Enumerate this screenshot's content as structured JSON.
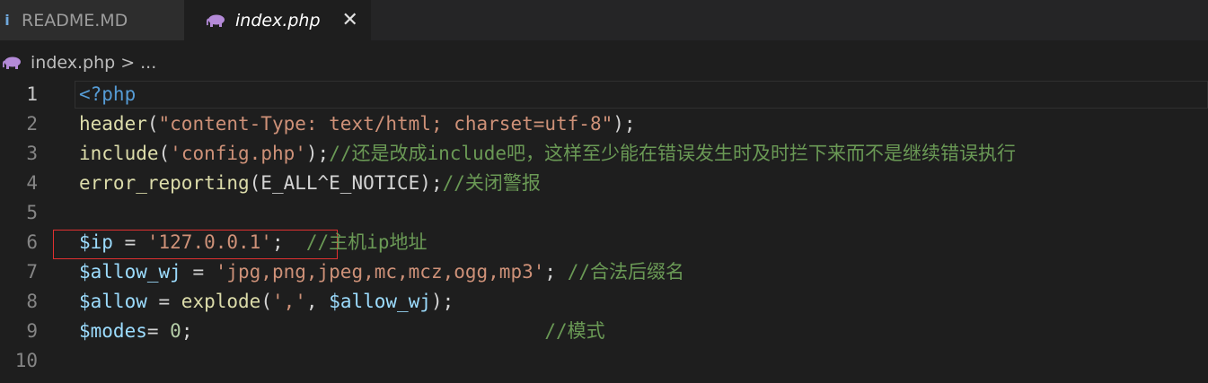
{
  "tabs": [
    {
      "label": "README.MD",
      "icon": "info-icon",
      "active": false
    },
    {
      "label": "index.php",
      "icon": "php-elephant-icon",
      "active": true
    }
  ],
  "breadcrumb": {
    "file": "index.php",
    "separator": ">",
    "rest": "..."
  },
  "editor": {
    "line_numbers": [
      "1",
      "2",
      "3",
      "4",
      "5",
      "6",
      "7",
      "8",
      "9",
      "10"
    ],
    "lines": [
      [
        [
          "kw",
          "<?php"
        ]
      ],
      [
        [
          "fn",
          "header"
        ],
        [
          "op",
          "("
        ],
        [
          "str",
          "\"content-Type: text/html; charset=utf-8\""
        ],
        [
          "op",
          ");"
        ]
      ],
      [
        [
          "fn",
          "include"
        ],
        [
          "op",
          "("
        ],
        [
          "str",
          "'config.php'"
        ],
        [
          "op",
          ");"
        ],
        [
          "cm",
          "//还是改成include吧，这样至少能在错误发生时及时拦下来而不是继续错误执行"
        ]
      ],
      [
        [
          "fn",
          "error_reporting"
        ],
        [
          "op",
          "(E_ALL^E_NOTICE);"
        ],
        [
          "cm",
          "//关闭警报"
        ]
      ],
      [],
      [
        [
          "var",
          "$ip"
        ],
        [
          "op",
          " = "
        ],
        [
          "str",
          "'127.0.0.1'"
        ],
        [
          "op",
          ";  "
        ],
        [
          "cm",
          "//主机ip地址"
        ]
      ],
      [
        [
          "var",
          "$allow_wj"
        ],
        [
          "op",
          " = "
        ],
        [
          "str",
          "'jpg,png,jpeg,mc,mcz,ogg,mp3'"
        ],
        [
          "op",
          "; "
        ],
        [
          "cm",
          "//合法后缀名"
        ]
      ],
      [
        [
          "var",
          "$allow"
        ],
        [
          "op",
          " = "
        ],
        [
          "fn",
          "explode"
        ],
        [
          "op",
          "("
        ],
        [
          "str",
          "','"
        ],
        [
          "op",
          ", "
        ],
        [
          "var",
          "$allow_wj"
        ],
        [
          "op",
          ");"
        ]
      ],
      [
        [
          "var",
          "$modes"
        ],
        [
          "op",
          "= "
        ],
        [
          "num",
          "0"
        ],
        [
          "op",
          ";                               "
        ],
        [
          "cm",
          "//模式"
        ]
      ],
      []
    ]
  },
  "colors": {
    "background": "#1e1e1e",
    "keyword": "#569cd6",
    "function": "#dcdcaa",
    "string": "#ce9178",
    "variable": "#9cdcfe",
    "comment": "#6a9955",
    "number": "#b5cea8",
    "selection_box": "#e03030"
  }
}
